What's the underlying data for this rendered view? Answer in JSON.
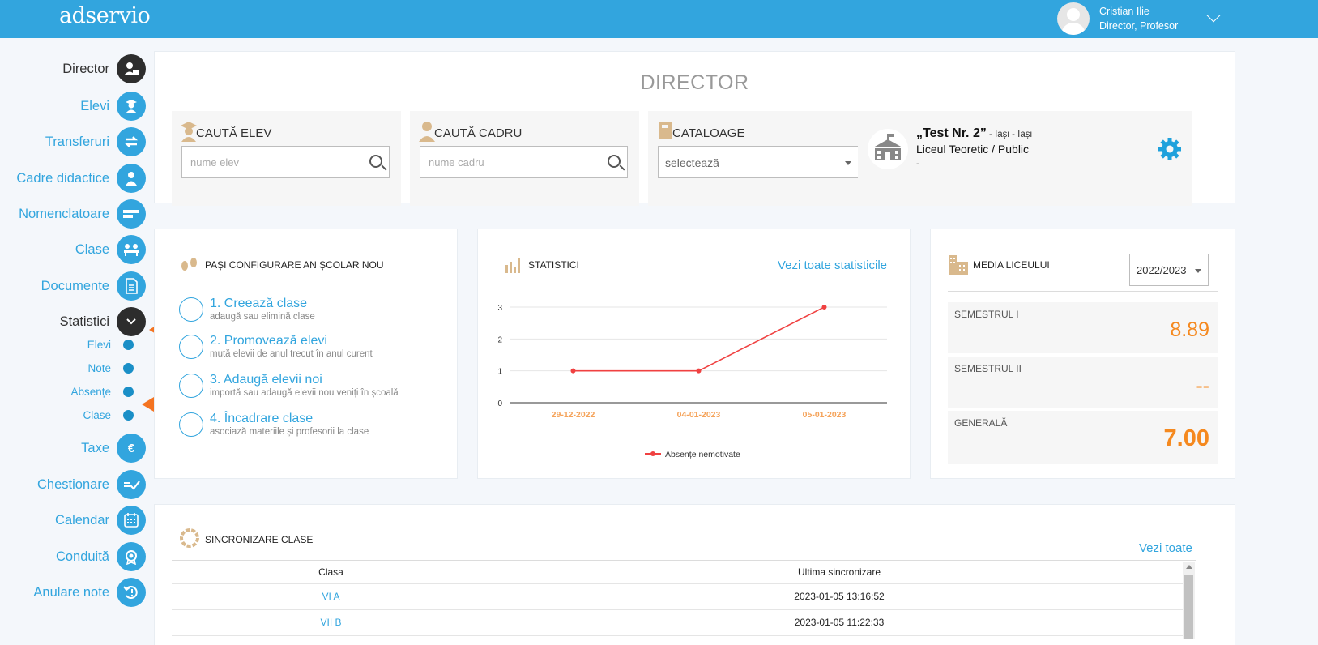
{
  "header": {
    "logo": "adservio",
    "user_name": "Cristian Ilie",
    "user_role": "Director, Profesor"
  },
  "sidebar": {
    "items": [
      {
        "label": "Director",
        "icon": "director-icon"
      },
      {
        "label": "Elevi",
        "icon": "student-icon"
      },
      {
        "label": "Transferuri",
        "icon": "transfer-icon"
      },
      {
        "label": "Cadre didactice",
        "icon": "teacher-icon"
      },
      {
        "label": "Nomenclatoare",
        "icon": "list-icon"
      },
      {
        "label": "Clase",
        "icon": "class-icon"
      },
      {
        "label": "Documente",
        "icon": "document-icon"
      },
      {
        "label": "Statistici",
        "icon": "chevron-down-icon"
      },
      {
        "label": "Taxe",
        "icon": "euro-icon"
      },
      {
        "label": "Chestionare",
        "icon": "checklist-icon"
      },
      {
        "label": "Calendar",
        "icon": "calendar-icon"
      },
      {
        "label": "Conduită",
        "icon": "badge-icon"
      },
      {
        "label": "Anulare note",
        "icon": "undo-grade-icon"
      }
    ],
    "statistici_sub": [
      "Elevi",
      "Note",
      "Absențe",
      "Clase"
    ],
    "euro_glyph": "€"
  },
  "director": {
    "title": "DIRECTOR",
    "search_student": {
      "title": "CAUTĂ ELEV",
      "placeholder": "nume elev"
    },
    "search_teacher": {
      "title": "CAUTĂ CADRU",
      "placeholder": "nume cadru"
    },
    "catalogs": {
      "title": "CATALOAGE",
      "selected": "selectează"
    },
    "school": {
      "name": "„Test Nr. 2”",
      "location": " - Iași - Iași",
      "type": "Liceul Teoretic / Public",
      "extra": "-"
    }
  },
  "setup": {
    "title": "PAȘI CONFIGURARE AN ȘCOLAR NOU",
    "steps": [
      {
        "title": "1. Creează clase",
        "desc": "adaugă sau elimină clase"
      },
      {
        "title": "2. Promovează elevi",
        "desc": "mută elevii de anul trecut în anul curent"
      },
      {
        "title": "3. Adaugă elevii noi",
        "desc": "importă sau adaugă elevii nou veniți în școală"
      },
      {
        "title": "4. Încadrare clase",
        "desc": "asociază materiile și profesorii la clase"
      }
    ]
  },
  "stats": {
    "title": "STATISTICI",
    "link": "Vezi toate statisticile"
  },
  "chart_data": {
    "type": "line",
    "categories": [
      "29-12-2022",
      "04-01-2023",
      "05-01-2023"
    ],
    "series": [
      {
        "name": "Absențe nemotivate",
        "values": [
          1,
          1,
          3
        ],
        "color": "#f04141"
      }
    ],
    "ylim": [
      0,
      3
    ],
    "yticks": [
      "0",
      "1",
      "2",
      "3"
    ],
    "legend": "bottom",
    "grid": true
  },
  "media": {
    "title": "MEDIA LICEULUI",
    "year": "2022/2023",
    "sem1": {
      "label": "SEMESTRUL I",
      "value": "8.89"
    },
    "sem2": {
      "label": "SEMESTRUL II",
      "value": "--"
    },
    "general": {
      "label": "GENERALĂ",
      "value": "7.00"
    }
  },
  "sync": {
    "title": "SINCRONIZARE CLASE",
    "link": "Vezi toate",
    "columns": [
      "Clasa",
      "Ultima sincronizare"
    ],
    "rows": [
      {
        "clasa": "VI A",
        "last": "2023-01-05 13:16:52"
      },
      {
        "clasa": "VII B",
        "last": "2023-01-05 11:22:33"
      }
    ]
  },
  "colors": {
    "accent": "#32a5de",
    "orange": "#f5891f",
    "arrow": "#f47421"
  }
}
